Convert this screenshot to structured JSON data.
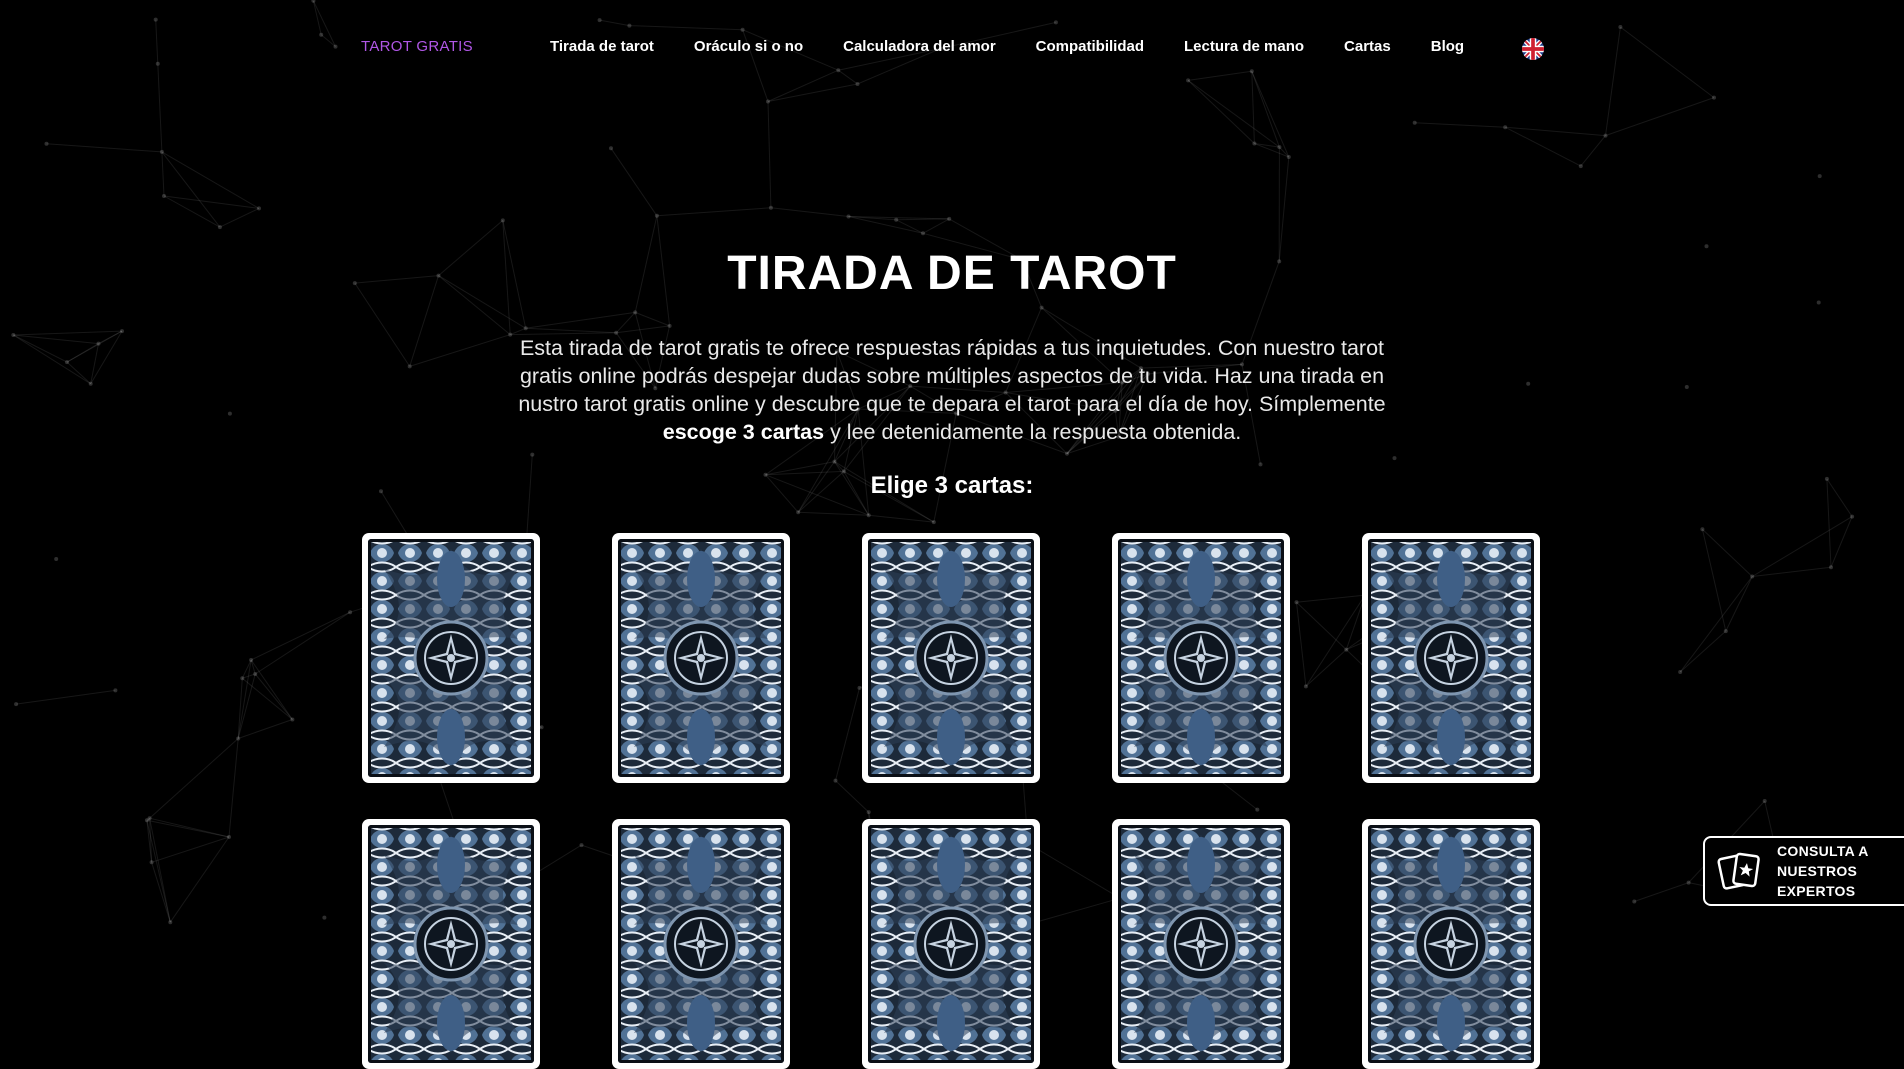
{
  "brand": "TAROT GRATIS",
  "nav": {
    "items": [
      {
        "label": "Tirada de tarot"
      },
      {
        "label": "Oráculo si o no"
      },
      {
        "label": "Calculadora del amor"
      },
      {
        "label": "Compatibilidad"
      },
      {
        "label": "Lectura de mano"
      },
      {
        "label": "Cartas"
      },
      {
        "label": "Blog"
      }
    ],
    "language_icon": "uk-flag-icon"
  },
  "hero": {
    "title": "TIRADA DE TAROT",
    "intro_part1": "Esta tirada de tarot gratis te ofrece respuestas rápidas a tus inquietudes. Con nuestro tarot gratis online podrás despejar dudas sobre múltiples aspectos de tu vida. Haz una tirada en nustro tarot gratis online y descubre que te depara el tarot para el día de hoy. Símplemente ",
    "intro_bold": "escoge 3 cartas",
    "intro_part2": " y lee detenidamente la respuesta obtenida.",
    "choose_label": "Elige 3 cartas:"
  },
  "cards": {
    "visible_count": 10,
    "card_back_icon": "tarot-card-back"
  },
  "cta": {
    "label": "CONSULTA A\nNUESTROS\nEXPERTOS",
    "icon": "tarot-cards-icon"
  },
  "colors": {
    "background": "#000000",
    "brand": "#b057e6",
    "text": "#ffffff",
    "card_blue": "#5a7fa6"
  }
}
